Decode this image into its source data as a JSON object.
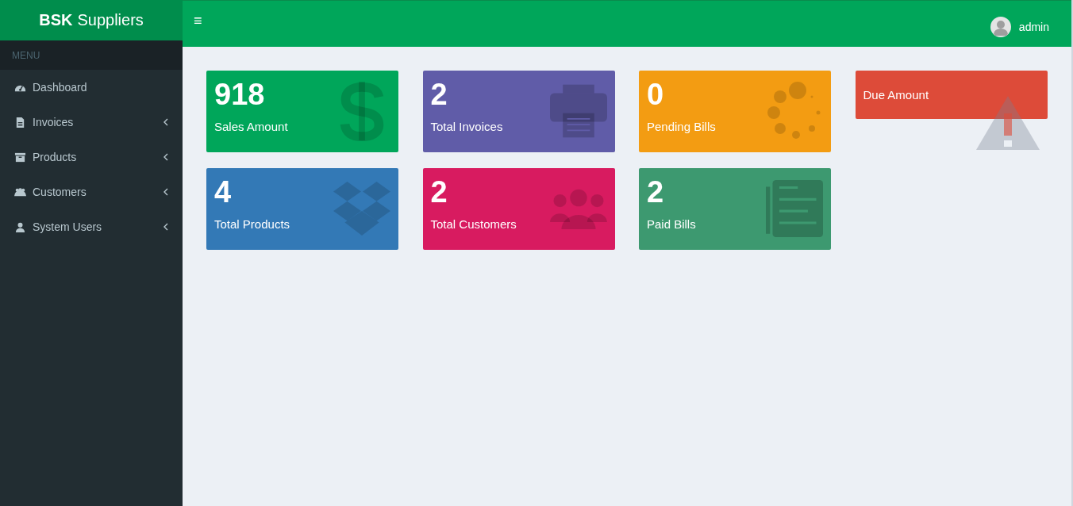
{
  "brand": {
    "bold": "BSK",
    "rest": "Suppliers"
  },
  "sidebar": {
    "header": "MENU",
    "items": [
      {
        "label": "Dashboard",
        "kind": "link"
      },
      {
        "label": "Invoices",
        "kind": "submenu"
      },
      {
        "label": "Products",
        "kind": "submenu"
      },
      {
        "label": "Customers",
        "kind": "submenu"
      },
      {
        "label": "System Users",
        "kind": "submenu"
      }
    ]
  },
  "topbar": {
    "menu_toggle": "≡",
    "user": "admin"
  },
  "cards": [
    {
      "value": "918",
      "label": "Sales Amount",
      "color": "#00a65a",
      "kind": "dollar"
    },
    {
      "value": "2",
      "label": "Total Invoices",
      "color": "#605ca8",
      "kind": "printer"
    },
    {
      "value": "0",
      "label": "Pending Bills",
      "color": "#f39c12",
      "kind": "spinner"
    },
    {
      "label": "Due Amount",
      "color": "#dd4b39",
      "kind": "warning"
    },
    {
      "value": "4",
      "label": "Total Products",
      "color": "#3379b6",
      "kind": "boxes"
    },
    {
      "value": "2",
      "label": "Total Customers",
      "color": "#d81b60",
      "kind": "people"
    },
    {
      "value": "2",
      "label": "Paid Bills",
      "color": "#3d9970",
      "kind": "newspaper"
    }
  ]
}
